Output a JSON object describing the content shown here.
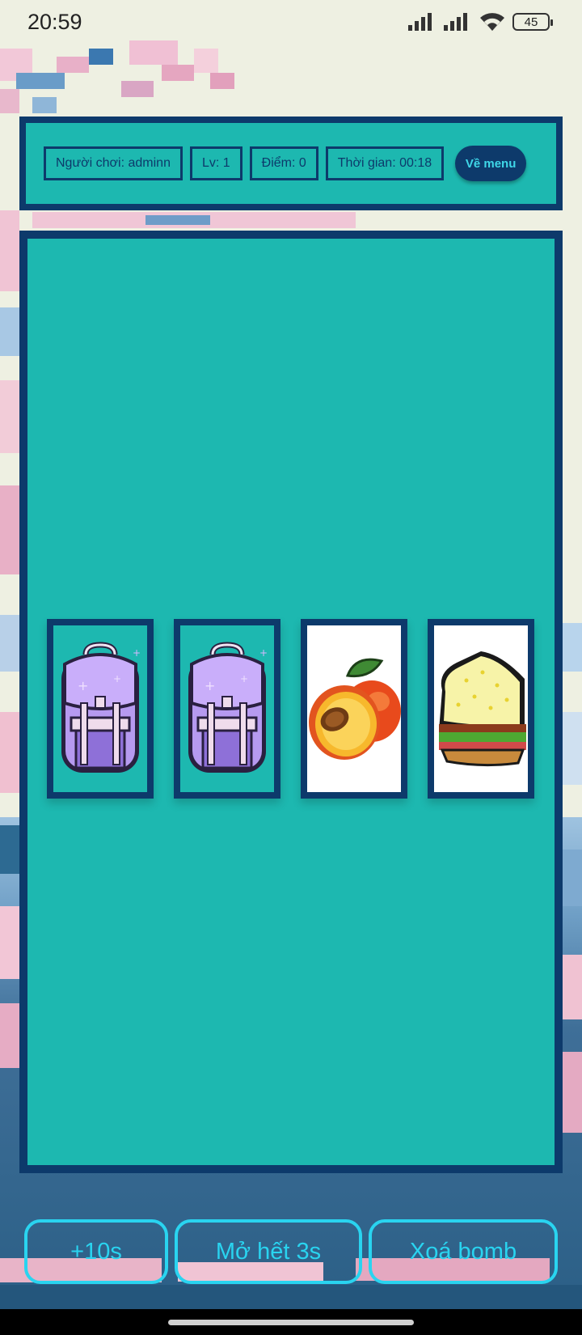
{
  "status": {
    "time": "20:59",
    "battery": "45"
  },
  "hud": {
    "player": "Người chơi: adminn",
    "level": "Lv: 1",
    "score": "Điểm: 0",
    "time": "Thời gian: 00:18",
    "menu_button": "Về menu"
  },
  "cards": [
    {
      "icon": "backpack-icon",
      "face": "backpack"
    },
    {
      "icon": "backpack-icon",
      "face": "backpack"
    },
    {
      "icon": "peach-icon",
      "face": "peach"
    },
    {
      "icon": "sandwich-icon",
      "face": "sandwich"
    }
  ],
  "powerups": {
    "add_time": "+10s",
    "reveal_all": "Mở hết 3s",
    "remove_bomb": "Xoá bomb"
  },
  "colors": {
    "panel": "#1db8b0",
    "border": "#0d3a6b",
    "accent": "#29d4f0"
  }
}
